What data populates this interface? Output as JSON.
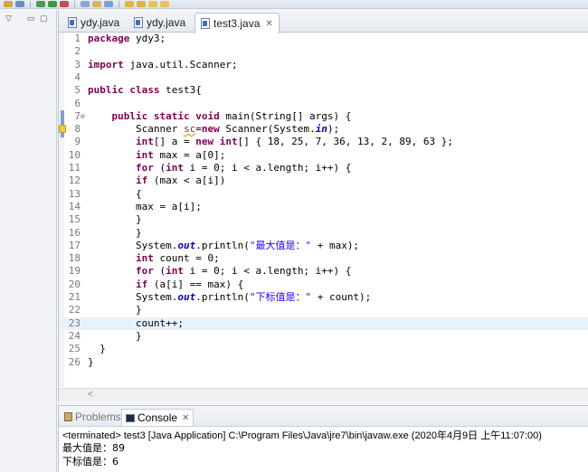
{
  "tabs": [
    {
      "label": "ydy.java",
      "active": false
    },
    {
      "label": "ydy.java",
      "active": false
    },
    {
      "label": "test3.java",
      "active": true
    }
  ],
  "close_glyph": "✕",
  "code_lines": [
    {
      "num": "1",
      "html": "<span class=\"kw\">package</span> ydy3;"
    },
    {
      "num": "2",
      "html": ""
    },
    {
      "num": "3",
      "html": "<span class=\"kw\">import</span> java.util.Scanner;"
    },
    {
      "num": "4",
      "html": ""
    },
    {
      "num": "5",
      "html": "<span class=\"kw\">public class</span> test3{"
    },
    {
      "num": "6",
      "html": ""
    },
    {
      "num": "7",
      "html": "    <span class=\"kw\">public static void</span> main(String[] args) {",
      "fold": true
    },
    {
      "num": "8",
      "html": "        Scanner <span class=\"var unused\">sc</span>=<span class=\"kw\">new</span> Scanner(System.<span class=\"fld\">in</span>);",
      "warning": true
    },
    {
      "num": "9",
      "html": "        <span class=\"kw\">int</span>[] a = <span class=\"kw\">new int</span>[] { 18, 25, 7, 36, 13, 2, 89, 63 };"
    },
    {
      "num": "10",
      "html": "        <span class=\"kw\">int</span> max = a[0];"
    },
    {
      "num": "11",
      "html": "        <span class=\"kw\">for</span> (<span class=\"kw\">int</span> i = 0; i &lt; a.length; i++) {"
    },
    {
      "num": "12",
      "html": "        <span class=\"kw\">if</span> (max &lt; a[i])"
    },
    {
      "num": "13",
      "html": "        {"
    },
    {
      "num": "14",
      "html": "        max = a[i];"
    },
    {
      "num": "15",
      "html": "        }"
    },
    {
      "num": "16",
      "html": "        }"
    },
    {
      "num": "17",
      "html": "        System.<span class=\"fld\">out</span>.println(<span class=\"str\">\"最大值是：\"</span> + max);"
    },
    {
      "num": "18",
      "html": "        <span class=\"kw\">int</span> count = 0;"
    },
    {
      "num": "19",
      "html": "        <span class=\"kw\">for</span> (<span class=\"kw\">int</span> i = 0; i &lt; a.length; i++) {"
    },
    {
      "num": "20",
      "html": "        <span class=\"kw\">if</span> (a[i] == max) {"
    },
    {
      "num": "21",
      "html": "        System.<span class=\"fld\">out</span>.println(<span class=\"str\">\"下标值是：\"</span> + count);"
    },
    {
      "num": "22",
      "html": "        }"
    },
    {
      "num": "23",
      "html": "        count++;",
      "current": true
    },
    {
      "num": "24",
      "html": "        }"
    },
    {
      "num": "25",
      "html": "  }"
    },
    {
      "num": "26",
      "html": "}"
    }
  ],
  "panel": {
    "problems_label": "Problems",
    "console_label": "Console",
    "status": "<terminated> test3 [Java Application] C:\\Program Files\\Java\\jre7\\bin\\javaw.exe (2020年4月9日 上午11:07:00)",
    "output": [
      "最大值是：89",
      "下标值是：6"
    ]
  }
}
